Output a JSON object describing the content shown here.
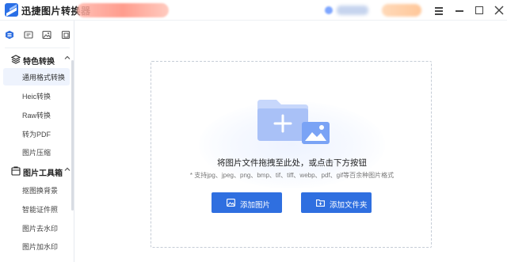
{
  "app": {
    "title": "迅捷图片转换器"
  },
  "colors": {
    "accent": "#2f6fe0",
    "sidebar_active_bg": "#eef3fd"
  },
  "titlebar": {
    "icons": [
      "menu-icon",
      "minimize-icon",
      "maximize-icon",
      "close-icon"
    ]
  },
  "quickbar": {
    "icons": [
      "home-icon",
      "convert-icon",
      "image-icon",
      "crop-icon"
    ]
  },
  "sidebar": {
    "groups": [
      {
        "label": "特色转换",
        "icon": "layers-icon",
        "expanded": true,
        "items": [
          "通用格式转换",
          "Heic转换",
          "Raw转换",
          "转为PDF",
          "图片压缩"
        ]
      },
      {
        "label": "图片工具箱",
        "icon": "toolbox-icon",
        "expanded": true,
        "items": [
          "抠图换背景",
          "智能证件照",
          "图片去水印",
          "图片加水印"
        ]
      }
    ],
    "active_item": "通用格式转换"
  },
  "dropzone": {
    "main_text": "将图片文件拖拽至此处，或点击下方按钮",
    "hint_text": "* 支持jpg、jpeg、png、bmp、tif、tiff、webp、pdf、gif等百余种图片格式",
    "add_image_label": "添加图片",
    "add_folder_label": "添加文件夹"
  }
}
